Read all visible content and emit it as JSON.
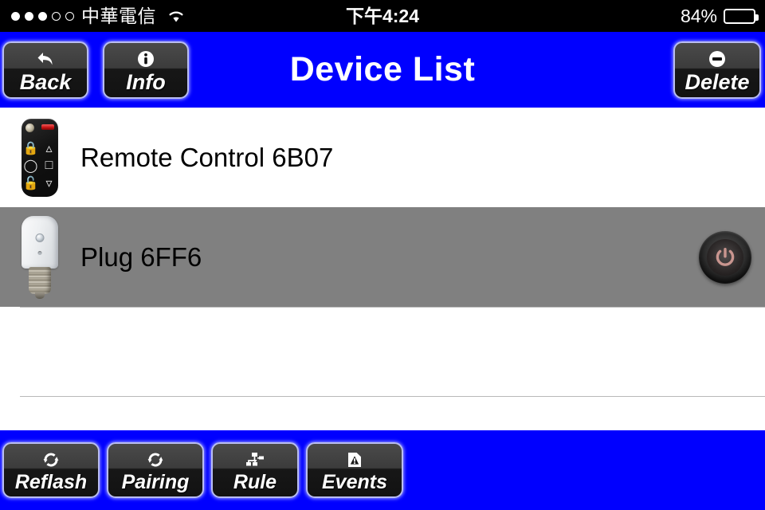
{
  "status_bar": {
    "signal_dots_filled": 3,
    "signal_dots_total": 5,
    "carrier": "中華電信",
    "wifi_icon": "wifi-icon",
    "time": "下午4:24",
    "battery_percent": "84%",
    "battery_level": 84
  },
  "navbar": {
    "title": "Device List",
    "back": {
      "label": "Back",
      "icon": "back-arrow-icon"
    },
    "info": {
      "label": "Info",
      "icon": "info-circle-icon"
    },
    "delete": {
      "label": "Delete",
      "icon": "minus-circle-icon"
    }
  },
  "devices": [
    {
      "name": "Remote Control 6B07",
      "icon": "remote-control-icon",
      "selected": false,
      "has_power_toggle": false
    },
    {
      "name": "Plug 6FF6",
      "icon": "smart-plug-icon",
      "selected": true,
      "has_power_toggle": true,
      "power_toggle_icon": "power-icon"
    }
  ],
  "toolbar": {
    "buttons": [
      {
        "label": "Reflash",
        "icon": "refresh-icon"
      },
      {
        "label": "Pairing",
        "icon": "sync-icon"
      },
      {
        "label": "Rule",
        "icon": "sitemap-icon"
      },
      {
        "label": "Events",
        "icon": "warning-document-icon"
      }
    ]
  },
  "colors": {
    "accent_blue": "#0000FF",
    "selected_row": "#808080",
    "status_bar": "#000000",
    "button_border": "#B9BDF2",
    "power_symbol": "#C9958F"
  }
}
